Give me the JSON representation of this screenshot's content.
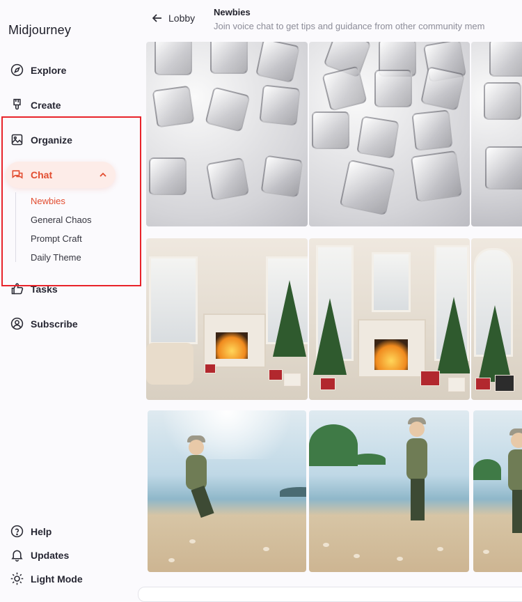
{
  "app": {
    "brand": "Midjourney"
  },
  "sidebar": {
    "nav": [
      {
        "label": "Explore",
        "icon": "compass-icon"
      },
      {
        "label": "Create",
        "icon": "brush-icon"
      },
      {
        "label": "Organize",
        "icon": "image-icon"
      },
      {
        "label": "Chat",
        "icon": "chat-icon",
        "expanded": true
      },
      {
        "label": "Tasks",
        "icon": "thumbs-up-icon"
      },
      {
        "label": "Subscribe",
        "icon": "user-circle-icon"
      }
    ],
    "chat_channels": [
      "Newbies",
      "General Chaos",
      "Prompt Craft",
      "Daily Theme"
    ],
    "active_channel": "Newbies",
    "footer": [
      {
        "label": "Help",
        "icon": "help-icon"
      },
      {
        "label": "Updates",
        "icon": "bell-icon"
      },
      {
        "label": "Light Mode",
        "icon": "sun-icon"
      }
    ]
  },
  "header": {
    "back_label": "Lobby",
    "channel_title": "Newbies",
    "channel_subtitle": "Join voice chat to get tips and guidance from other community mem"
  },
  "colors": {
    "accent": "#e24c2f",
    "annotation": "#e8232a"
  },
  "gallery_rows": [
    {
      "theme": "ice cubes",
      "count": 3
    },
    {
      "theme": "christmas living room",
      "count": 3
    },
    {
      "theme": "boy on beach",
      "count": 3
    }
  ]
}
